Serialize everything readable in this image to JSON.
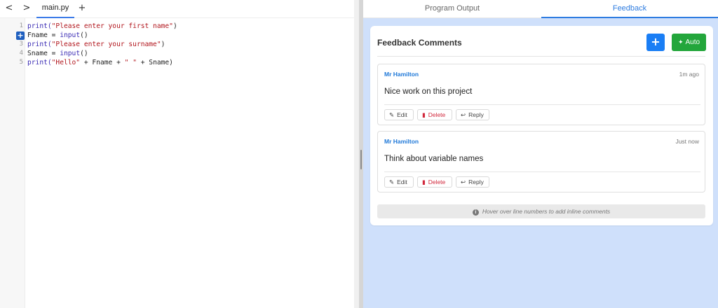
{
  "editor": {
    "nav_back": "<",
    "nav_forward": ">",
    "file_tab": "main.py",
    "add_tab": "+",
    "line_numbers": [
      "1",
      "2",
      "3",
      "4",
      "5"
    ],
    "add_comment_icon": "+",
    "lines": [
      {
        "tokens": [
          {
            "t": "print(",
            "c": "fn"
          },
          {
            "t": "\"Please enter your first name\"",
            "c": "str"
          },
          {
            "t": ")",
            "c": "op"
          }
        ]
      },
      {
        "tokens": [
          {
            "t": "Fname = ",
            "c": "op"
          },
          {
            "t": "input",
            "c": "fn"
          },
          {
            "t": "()",
            "c": "op"
          }
        ]
      },
      {
        "tokens": [
          {
            "t": "print(",
            "c": "fn"
          },
          {
            "t": "\"Please enter your surname\"",
            "c": "str"
          },
          {
            "t": ")",
            "c": "op"
          }
        ]
      },
      {
        "tokens": [
          {
            "t": "Sname = ",
            "c": "op"
          },
          {
            "t": "input",
            "c": "fn"
          },
          {
            "t": "()",
            "c": "op"
          }
        ]
      },
      {
        "tokens": [
          {
            "t": "print(",
            "c": "fn"
          },
          {
            "t": "\"Hello\"",
            "c": "str"
          },
          {
            "t": " + Fname + ",
            "c": "op"
          },
          {
            "t": "\" \"",
            "c": "str"
          },
          {
            "t": " + Sname)",
            "c": "op"
          }
        ]
      }
    ]
  },
  "right_tabs": {
    "program_output": "Program Output",
    "feedback": "Feedback"
  },
  "feedback": {
    "title": "Feedback Comments",
    "add_button_label": "+",
    "auto_button_label": "Auto",
    "comments": [
      {
        "author": "Mr Hamilton",
        "time": "1m ago",
        "text": "Nice work on this project"
      },
      {
        "author": "Mr Hamilton",
        "time": "Just now",
        "text": "Think about variable names"
      }
    ],
    "actions": {
      "edit": "Edit",
      "delete": "Delete",
      "reply": "Reply"
    },
    "hint": "Hover over line numbers to add inline comments"
  },
  "icons": {
    "auto": "magic-wand-icon",
    "edit": "edit-icon",
    "delete": "trash-icon",
    "reply": "reply-icon",
    "hint": "info-icon"
  },
  "colors": {
    "accent": "#2e7ce0",
    "add_button": "#1a7ef5",
    "auto_button": "#23a63b",
    "delete": "#d1283c",
    "panel_background": "#cfe0fb"
  }
}
